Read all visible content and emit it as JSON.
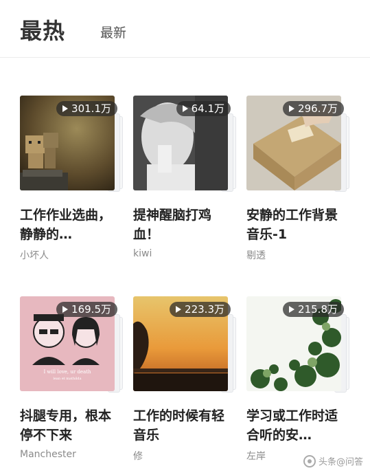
{
  "tabs": {
    "active": "最热",
    "other": "最新"
  },
  "playlists": [
    {
      "title": "工作作业选曲，静静的…",
      "author": "小坏人",
      "plays": "301.1万"
    },
    {
      "title": "提神醒脑打鸡血！",
      "author": "kiwi",
      "plays": "64.1万"
    },
    {
      "title": "安静的工作背景音乐-1",
      "author": "剔透",
      "plays": "296.7万"
    },
    {
      "title": "抖腿专用，根本停不下来",
      "author": "Manchester",
      "plays": "169.5万"
    },
    {
      "title": "工作的时候有轻音乐",
      "author": "修",
      "plays": "223.3万"
    },
    {
      "title": "学习或工作时适合听的安…",
      "author": "左岸",
      "plays": "215.8万"
    }
  ],
  "cover_art": {
    "card5_text": "I will love, ur death",
    "card5_sub": "lean et mathilda"
  },
  "watermark": "头条@问答",
  "icons": {
    "play": "play-icon",
    "watermark": "toutiao-logo-icon"
  }
}
